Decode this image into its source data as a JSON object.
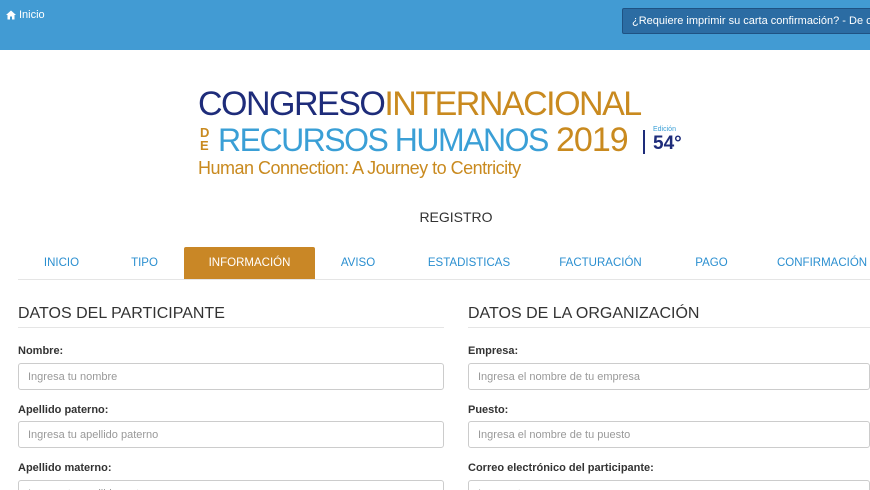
{
  "topbar": {
    "home_label": "Inicio",
    "print_label": "¿Requiere imprimir su carta confirmación? - De clic aquí"
  },
  "logo": {
    "line1_part1": "CONGRESO",
    "line1_part2": "INTERNACIONAL",
    "de_top": "D",
    "de_bottom": "E",
    "line2": "RECURSOS HUMANOS",
    "year": "2019",
    "edicion_label": "Edición",
    "edition_number": "54°",
    "tagline": "Human Connection: A Journey to Centricity"
  },
  "page_title": "REGISTRO",
  "tabs": [
    {
      "label": "INICIO"
    },
    {
      "label": "TIPO"
    },
    {
      "label": "INFORMACIÓN",
      "active": true
    },
    {
      "label": "AVISO"
    },
    {
      "label": "ESTADISTICAS"
    },
    {
      "label": "FACTURACIÓN"
    },
    {
      "label": "PAGO"
    },
    {
      "label": "CONFIRMACIÓN"
    }
  ],
  "participante": {
    "heading": "DATOS DEL PARTICIPANTE",
    "fields": [
      {
        "label": "Nombre:",
        "placeholder": "Ingresa tu nombre"
      },
      {
        "label": "Apellido paterno:",
        "placeholder": "Ingresa tu apellido paterno"
      },
      {
        "label": "Apellido materno:",
        "placeholder": "Ingresa tu apellido materno"
      }
    ]
  },
  "organizacion": {
    "heading": "DATOS DE LA ORGANIZACIÓN",
    "fields": [
      {
        "label": "Empresa:",
        "placeholder": "Ingresa el nombre de tu empresa"
      },
      {
        "label": "Puesto:",
        "placeholder": "Ingresa el nombre de tu puesto"
      },
      {
        "label": "Correo electrónico del participante:",
        "placeholder": "Ingresa tu correo"
      }
    ]
  },
  "colors": {
    "topbar": "#429bd3",
    "active_tab": "#c98726",
    "tab_text": "#2b8fd0",
    "logo_navy": "#1e2c7a",
    "logo_gold": "#c98a1f",
    "logo_blue": "#3a9fd6"
  },
  "icons": {
    "home": "home-icon"
  }
}
